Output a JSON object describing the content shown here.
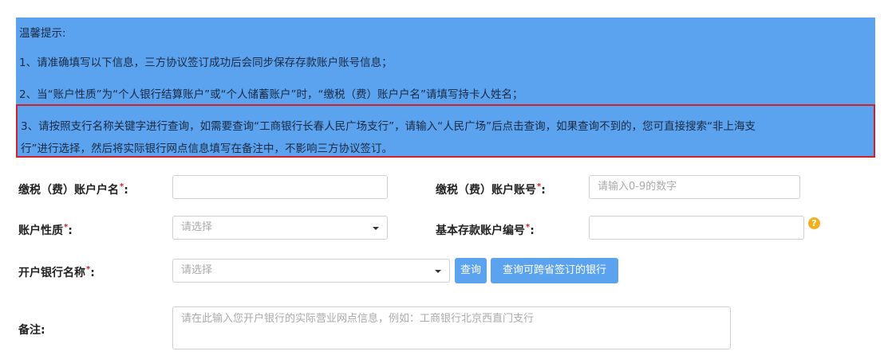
{
  "notice": {
    "title": "温馨提示:",
    "item1": "1、请准确填写以下信息，三方协议签订成功后会同步保存存款账户账号信息；",
    "item2": "2、当“账户性质”为“个人银行结算账户”或“个人储蓄账户”时，“缴税（费）账户户名”请填写持卡人姓名；",
    "item3_line1": "3、请按照支行名称关键字进行查询，如需要查询“工商银行长春人民广场支行”，请输入“人民广场”后点击查询，如果查询不到的，您可直接搜索“非上海支",
    "item3_line2": "行”进行选择，然后将实际银行网点信息填写在备注中，不影响三方协议签订。"
  },
  "form": {
    "account_name_label": "缴税（费）账户户名",
    "account_name_value": "",
    "account_number_label": "缴税（费）账户账号",
    "account_number_placeholder": "请输入0-9的数字",
    "account_type_label": "账户性质",
    "account_type_value": "请选择",
    "deposit_code_label": "基本存款账户编号",
    "deposit_code_value": "",
    "bank_name_label": "开户银行名称",
    "bank_name_value": "请选择",
    "query_button": "查询",
    "query_bank_button": "查询可跨省签订的银行",
    "remark_label": "备注",
    "remark_placeholder": "请在此输入您开户银行的实际营业网点信息，例如：工商银行北京西直门支行",
    "required_mark": "*",
    "colon": ":",
    "help_icon": "?"
  },
  "colors": {
    "notice_bg": "#5ba3ee",
    "highlight_border": "#d0202a",
    "button_bg": "#5ba3ee",
    "required": "#d0202a",
    "help": "#f2b01e"
  }
}
